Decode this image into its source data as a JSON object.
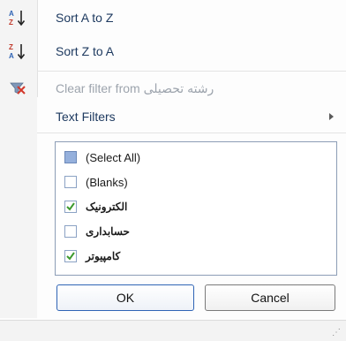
{
  "menu": {
    "sort_az": "Sort A to Z",
    "sort_za": "Sort Z to A",
    "clear_filter": "Clear filter from رشته تحصیلی",
    "text_filters": "Text Filters"
  },
  "icons": {
    "sort_az": "sort-ascending-icon",
    "sort_za": "sort-descending-icon",
    "clear_filter": "clear-filter-icon",
    "submenu": "submenu-arrow-icon"
  },
  "list": {
    "items": [
      {
        "label": "(Select All)",
        "checked": "partial"
      },
      {
        "label": "(Blanks)",
        "checked": false
      },
      {
        "label": "الکترونیک",
        "checked": true
      },
      {
        "label": "حسابداری",
        "checked": false
      },
      {
        "label": "کامپیوتر",
        "checked": true
      }
    ]
  },
  "buttons": {
    "ok": "OK",
    "cancel": "Cancel"
  },
  "colors": {
    "accent": "#2f64b5",
    "label_text": "#1e3a60",
    "disabled_text": "#9da4ad",
    "check": "#3c9a2e"
  }
}
